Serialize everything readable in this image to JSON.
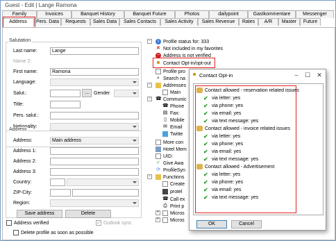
{
  "window": {
    "title": "Guest - Edit | Lange Ramona"
  },
  "tabs_row1": [
    "Family",
    "Invoices",
    "Banquet History",
    "Banquet Future",
    "Photos",
    "dailypoint",
    "Gastkommentare",
    "Messenger"
  ],
  "tabs_row2": [
    "Address",
    "Pers. Data",
    "Requests",
    "Sales Data",
    "Sales Contacts",
    "Sales Activity",
    "Sales Revenue",
    "Rates",
    "A/R",
    "Master",
    "Future"
  ],
  "salutation": {
    "title": "Salutation",
    "last_name_label": "Last name:",
    "last_name": "Lange",
    "name2_label": "Name 2:",
    "first_name_label": "First name:",
    "first_name": "Ramona",
    "language_label": "Language:",
    "salut_label": "Salut.:",
    "salut_btn": "...",
    "gender_label": "Gender",
    "title_label": "Title:",
    "pers_salut_label": "Pers. salut.:",
    "nationality_label": "Nationality:"
  },
  "address": {
    "title": "Address",
    "address_label": "Address:",
    "address_value": "Main address",
    "address1_label": "Address 1:",
    "address2_label": "Address 2:",
    "address3_label": "Address 3:",
    "country_label": "Country:",
    "zip_label": "ZIP-City:",
    "region_label": "Region:",
    "save_button": "Save address",
    "delete_button": "Delete",
    "verified_label": "Address verified",
    "outlook_label": "Outlook sync."
  },
  "delete_profile_label": "Delete profile as soon as possible",
  "tree": [
    {
      "icon": "info",
      "label": "Profile status for: 333"
    },
    {
      "icon": "x",
      "label": "Not included in my favorites"
    },
    {
      "icon": "minus",
      "label": "Address is not verified"
    },
    {
      "icon": "people",
      "label": "Contact Opt-in/opt-out"
    },
    {
      "icon": "doc",
      "label": "Profile pro"
    },
    {
      "icon": "search",
      "label": "Search na"
    },
    {
      "icon": "folder",
      "label": "Addresses"
    },
    {
      "icon": "doc",
      "label": "Main"
    },
    {
      "icon": "phone",
      "label": "Communic"
    },
    {
      "icon": "phone",
      "label": "Phone"
    },
    {
      "icon": "fax",
      "label": "Fax:"
    },
    {
      "icon": "mobile",
      "label": "Mobile"
    },
    {
      "icon": "mail",
      "label": "Email"
    },
    {
      "icon": "twitter",
      "label": "Twitte"
    },
    {
      "icon": "doc",
      "label": "More con"
    },
    {
      "icon": "hotel",
      "label": "Hotel Mem"
    },
    {
      "icon": "id",
      "label": "UID:"
    },
    {
      "icon": "check",
      "label": "Give Awa"
    },
    {
      "icon": "sync",
      "label": "ProfileSyn"
    },
    {
      "icon": "folder",
      "label": "Functions"
    },
    {
      "icon": "doc",
      "label": "Create"
    },
    {
      "icon": "doc",
      "label": "protel"
    },
    {
      "icon": "phone",
      "label": "Call ex"
    },
    {
      "icon": "print",
      "label": "Print p"
    },
    {
      "icon": "doc",
      "label": "Micros"
    },
    {
      "icon": "doc",
      "label": "Micros"
    }
  ],
  "popup": {
    "title": "Contact Opt-in",
    "groups": [
      {
        "label": "Contact allowed - reservation related issues",
        "items": [
          "via letter: yes",
          "via phone: yes",
          "via email: yes",
          "via text message: yes"
        ]
      },
      {
        "label": "Contact allowed - invoice related issues",
        "items": [
          "via letter: yes",
          "via phone: yes",
          "via email: yes",
          "via text message: yes"
        ]
      },
      {
        "label": "Contact allowed - Advertisement",
        "items": [
          "via letter: yes",
          "via phone: yes",
          "via email: yes",
          "via text message: yes"
        ]
      }
    ],
    "ok_button": "OK",
    "cancel_button": "Cancel",
    "minimize": "–",
    "maximize": "☐",
    "close": "✕"
  },
  "colors": {
    "highlight_red": "#e02020",
    "check_green": "#2a9d2a"
  }
}
